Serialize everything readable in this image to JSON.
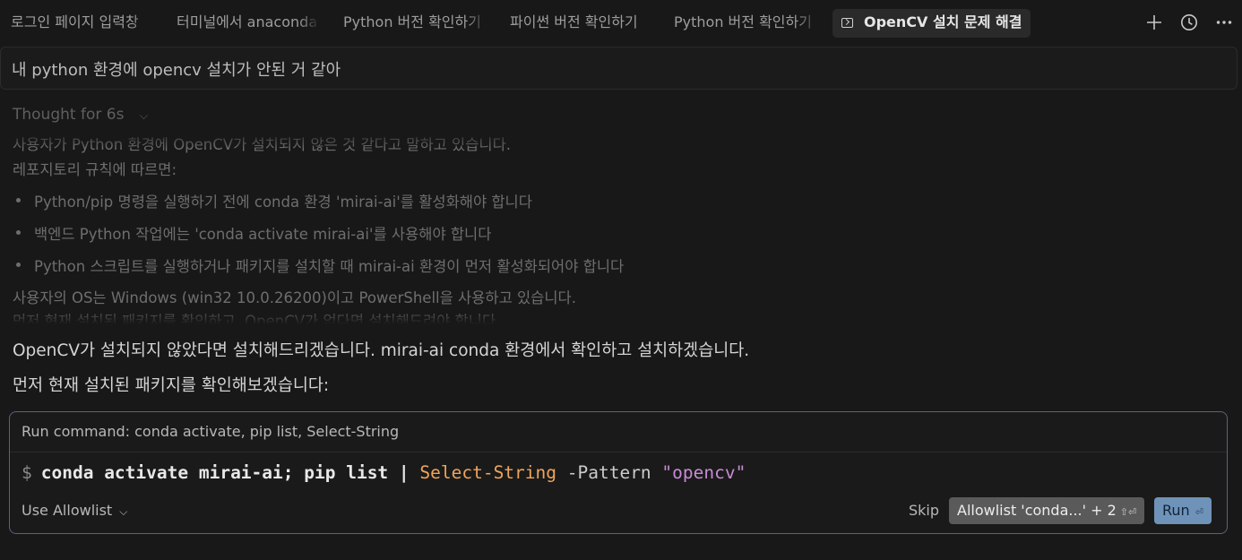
{
  "tabs": [
    {
      "label": "로그인 페이지 입력창"
    },
    {
      "label": "터미널에서 anaconda"
    },
    {
      "label": "Python 버전 확인하기"
    },
    {
      "label": "파이썬 버전 확인하기"
    },
    {
      "label": "Python 버전 확인하기"
    },
    {
      "label": "OpenCV 설치 문제 해결",
      "active": true
    }
  ],
  "toolbar_icons": [
    "plus-icon",
    "history-icon",
    "more-icon"
  ],
  "prompt": "내 python 환경에 opencv 설치가 안된 거 같아",
  "thought": {
    "header": "Thought",
    "duration": "for 6s",
    "line1": "사용자가 Python 환경에 OpenCV가 설치되지 않은 것 같다고 말하고 있습니다.",
    "line2": "레포지토리 규칙에 따르면:",
    "bullets": [
      "Python/pip 명령을 실행하기 전에 conda 환경 'mirai-ai'를 활성화해야 합니다",
      "백엔드 Python 작업에는 'conda activate mirai-ai'를 사용해야 합니다",
      "Python 스크립트를 실행하거나 패키지를 설치할 때 mirai-ai 환경이 먼저 활성화되어야 합니다"
    ],
    "line3": "사용자의 OS는 Windows (win32 10.0.26200)이고 PowerShell을 사용하고 있습니다.",
    "line4": "먼저 현재 설치된 패키지를 확인하고, OpenCV가 없다면 설치해드려야 합니다."
  },
  "answer": {
    "line1": "OpenCV가 설치되지 않았다면 설치해드리겠습니다. mirai-ai conda 환경에서 확인하고 설치하겠습니다.",
    "line2": "먼저 현재 설치된 패키지를 확인해보겠습니다:"
  },
  "command_card": {
    "title": "Run command: conda activate, pip list, Select-String",
    "prompt_symbol": "$",
    "cmd_part1": "conda activate mirai-ai; pip list | ",
    "cmd_cmdlet": "Select-String",
    "cmd_param": " -Pattern ",
    "cmd_string": "\"opencv\"",
    "mode_label": "Use Allowlist",
    "skip_label": "Skip",
    "allow_label": "Allowlist 'conda...' + 2",
    "allow_shortcut": "⇧⏎",
    "run_label": "Run",
    "run_shortcut": "⏎"
  }
}
